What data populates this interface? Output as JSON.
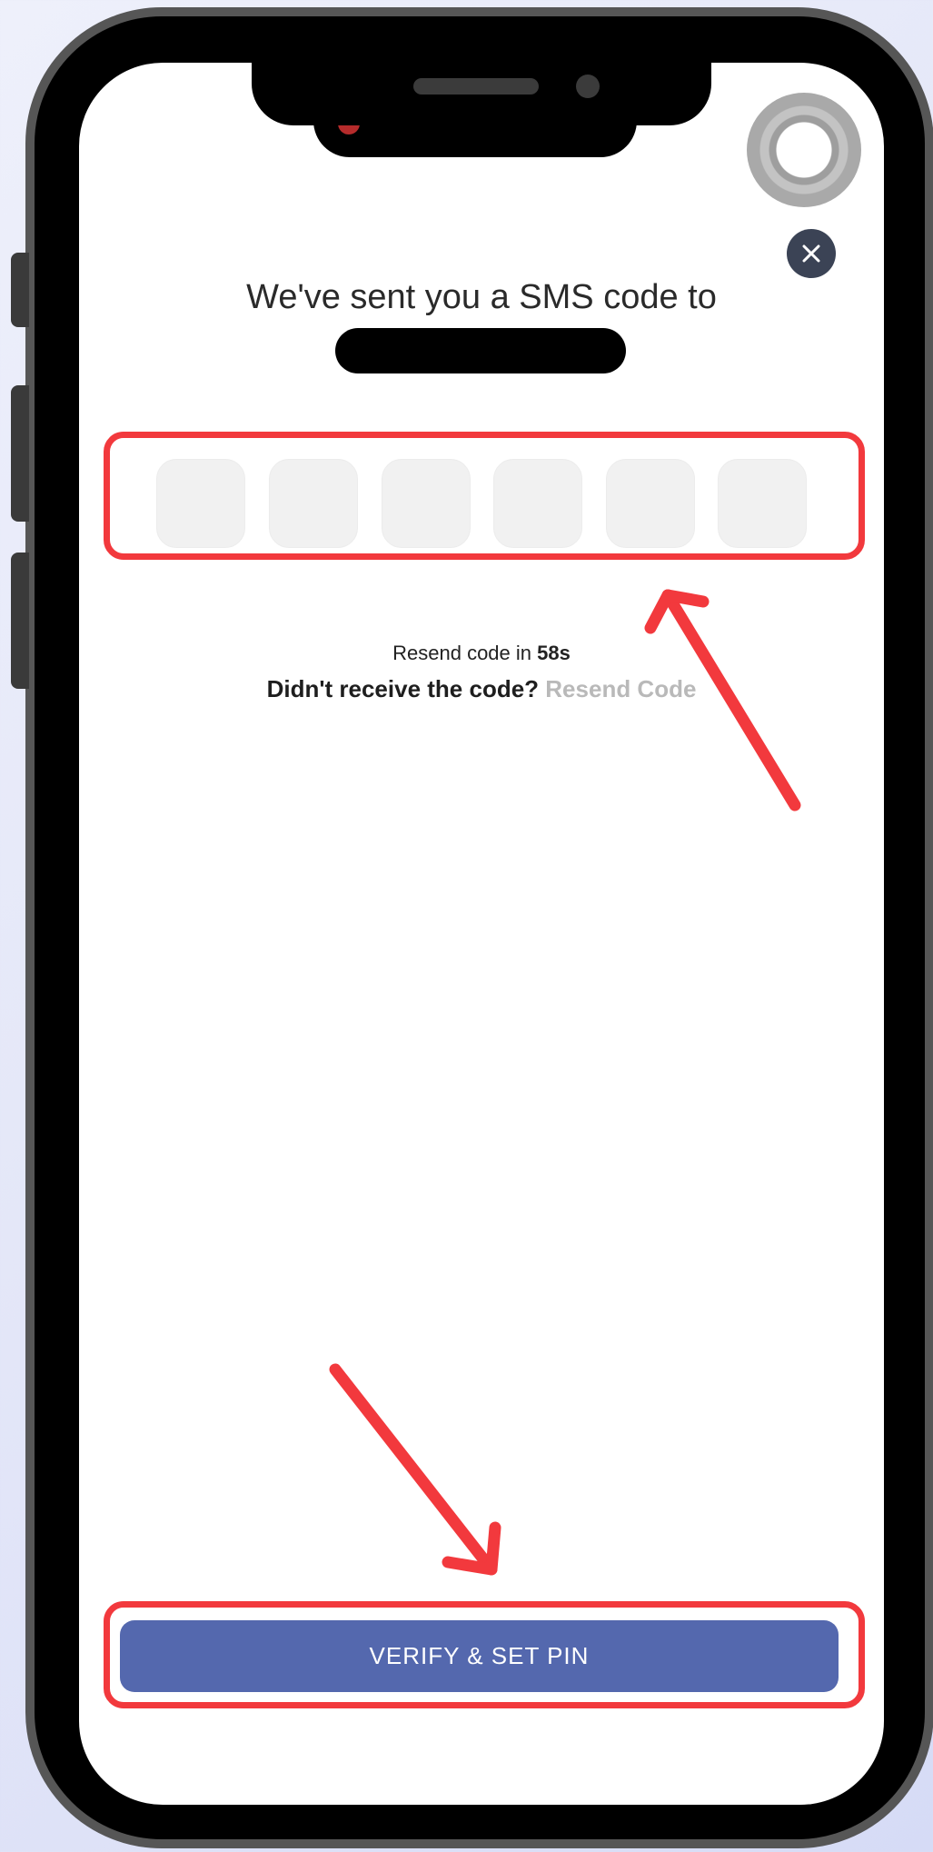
{
  "screen": {
    "heading": "We've sent you a SMS code to",
    "otp": {
      "length": 6,
      "cells": [
        "",
        "",
        "",
        "",
        "",
        ""
      ]
    },
    "resend_timer": {
      "prefix": "Resend code in",
      "seconds": "58s"
    },
    "resend_row": {
      "question": "Didn't receive the code?",
      "link": "Resend Code"
    },
    "verify_button": "VERIFY & SET PIN"
  },
  "icons": {
    "close": "close-icon",
    "assistive_touch": "assistive-touch-icon",
    "arrow": "arrow-icon"
  },
  "colors": {
    "highlight": "#f2393d",
    "primary_button": "#5468ae",
    "close_button": "#3b4355",
    "resend_link": "#b9b9b9"
  }
}
